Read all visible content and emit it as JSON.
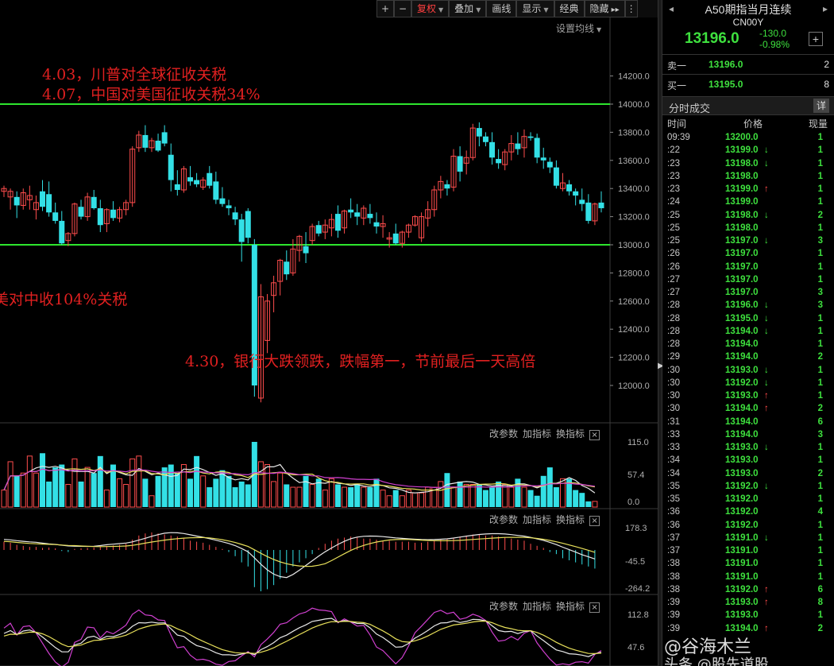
{
  "toolbar": {
    "buttons": [
      "+",
      "−",
      "复权",
      "叠加",
      "画线",
      "显示",
      "经典",
      "隐藏"
    ],
    "fuquan": "复权",
    "diejia": "叠加",
    "huaxian": "画线",
    "xianshi": "显示",
    "jingdian": "经典",
    "yincang": "隐藏",
    "more": "▸▸",
    "scroll": "⋮"
  },
  "setting_label": "设置均线",
  "annotations": {
    "a1": "4.03，川普对全球征收关税",
    "a2": "4.07，中国对美国征收关税34%",
    "a3": "美对中收104%关税",
    "a4": "4.30，银行大跌领跌，跌幅第一，节前最后一天高倍"
  },
  "price_axis": [
    "14200.0",
    "14000.0",
    "13800.0",
    "13600.0",
    "13400.0",
    "13200.0",
    "13000.0",
    "12800.0",
    "12600.0",
    "12400.0",
    "12200.0",
    "12000.0"
  ],
  "hlines": [
    14000,
    13000
  ],
  "panels": {
    "vol": {
      "ctrl": [
        "改参数",
        "加指标",
        "换指标"
      ],
      "axis": [
        "115.0",
        "57.4",
        "0.0"
      ]
    },
    "macd": {
      "ctrl": [
        "改参数",
        "加指标",
        "换指标"
      ],
      "axis": [
        "178.3",
        "-45.5",
        "-264.2"
      ]
    },
    "kdj": {
      "ctrl": [
        "改参数",
        "加指标",
        "换指标"
      ],
      "axis": [
        "112.8",
        "47.6"
      ]
    }
  },
  "colors": {
    "up": "#ff4d4d",
    "down": "#33e0e6",
    "line_green": "#2ee62e",
    "annot_red": "#e02020",
    "ma_white": "#e8e8e8",
    "ma_yellow": "#e8e05a",
    "ma_magenta": "#d040d0"
  },
  "chart_data": {
    "type": "candlestick",
    "y_range": [
      11900,
      14300
    ],
    "candles": [
      [
        13380,
        13420,
        13340,
        13400
      ],
      [
        13340,
        13400,
        13250,
        13380
      ],
      [
        13340,
        13380,
        13190,
        13280
      ],
      [
        13280,
        13400,
        13250,
        13370
      ],
      [
        13320,
        13420,
        13250,
        13350
      ],
      [
        13250,
        13350,
        13180,
        13300
      ],
      [
        13380,
        13460,
        13240,
        13270
      ],
      [
        13360,
        13450,
        13200,
        13230
      ],
      [
        13230,
        13300,
        13150,
        13170
      ],
      [
        13170,
        13240,
        13000,
        13010
      ],
      [
        13030,
        13090,
        12990,
        13080
      ],
      [
        13080,
        13300,
        13060,
        13290
      ],
      [
        13270,
        13320,
        13180,
        13200
      ],
      [
        13200,
        13370,
        13170,
        13340
      ],
      [
        13340,
        13390,
        13250,
        13260
      ],
      [
        13260,
        13320,
        13090,
        13140
      ],
      [
        13150,
        13260,
        13090,
        13250
      ],
      [
        13250,
        13310,
        13170,
        13190
      ],
      [
        13190,
        13270,
        13160,
        13250
      ],
      [
        13250,
        13320,
        13210,
        13300
      ],
      [
        13300,
        13700,
        13270,
        13680
      ],
      [
        13690,
        13810,
        13660,
        13780
      ],
      [
        13780,
        13850,
        13660,
        13690
      ],
      [
        13690,
        13760,
        13660,
        13740
      ],
      [
        13740,
        13790,
        13660,
        13670
      ],
      [
        13800,
        13850,
        13700,
        13720
      ],
      [
        13640,
        13720,
        13380,
        13460
      ],
      [
        13430,
        13530,
        13350,
        13390
      ],
      [
        13390,
        13560,
        13370,
        13540
      ],
      [
        13480,
        13560,
        13420,
        13450
      ],
      [
        13460,
        13510,
        13410,
        13430
      ],
      [
        13410,
        13480,
        13390,
        13460
      ],
      [
        13510,
        13560,
        13400,
        13420
      ],
      [
        13450,
        13520,
        13290,
        13320
      ],
      [
        13330,
        13410,
        13270,
        13290
      ],
      [
        13280,
        13320,
        13210,
        13260
      ],
      [
        13230,
        13270,
        13140,
        13180
      ],
      [
        13180,
        13220,
        12880,
        13020
      ],
      [
        13240,
        13260,
        13010,
        13050
      ],
      [
        13000,
        13040,
        11920,
        12000
      ],
      [
        11910,
        12720,
        11880,
        12630
      ],
      [
        12320,
        12650,
        12230,
        12600
      ],
      [
        12640,
        12780,
        12520,
        12730
      ],
      [
        12740,
        12900,
        12640,
        12890
      ],
      [
        12880,
        12960,
        12750,
        12790
      ],
      [
        12800,
        13040,
        12780,
        12970
      ],
      [
        12960,
        13070,
        12880,
        13060
      ],
      [
        12990,
        13090,
        12870,
        12940
      ],
      [
        13030,
        13150,
        13000,
        13130
      ],
      [
        13140,
        13170,
        13060,
        13080
      ],
      [
        13090,
        13180,
        13040,
        13140
      ],
      [
        13120,
        13220,
        13060,
        13180
      ],
      [
        13220,
        13280,
        13050,
        13100
      ],
      [
        13120,
        13250,
        13080,
        13240
      ],
      [
        13250,
        13330,
        13190,
        13230
      ],
      [
        13230,
        13290,
        13140,
        13200
      ],
      [
        13190,
        13280,
        13140,
        13260
      ],
      [
        13220,
        13290,
        13150,
        13190
      ],
      [
        13160,
        13230,
        13080,
        13130
      ],
      [
        13130,
        13210,
        13050,
        13150
      ],
      [
        13040,
        13090,
        12980,
        13050
      ],
      [
        13080,
        13150,
        13000,
        13010
      ],
      [
        13010,
        13100,
        12980,
        13090
      ],
      [
        13090,
        13150,
        13050,
        13140
      ],
      [
        13140,
        13210,
        13130,
        13200
      ],
      [
        13050,
        13230,
        13020,
        13200
      ],
      [
        13190,
        13310,
        13130,
        13250
      ],
      [
        13250,
        13420,
        13200,
        13390
      ],
      [
        13390,
        13490,
        13330,
        13450
      ],
      [
        13430,
        13460,
        13350,
        13400
      ],
      [
        13410,
        13680,
        13380,
        13630
      ],
      [
        13630,
        13700,
        13450,
        13520
      ],
      [
        13580,
        13670,
        13500,
        13620
      ],
      [
        13620,
        13860,
        13600,
        13830
      ],
      [
        13830,
        13870,
        13700,
        13770
      ],
      [
        13770,
        13800,
        13700,
        13730
      ],
      [
        13730,
        13800,
        13570,
        13620
      ],
      [
        13610,
        13680,
        13540,
        13580
      ],
      [
        13570,
        13680,
        13530,
        13660
      ],
      [
        13660,
        13780,
        13600,
        13720
      ],
      [
        13720,
        13800,
        13640,
        13680
      ],
      [
        13690,
        13820,
        13620,
        13770
      ],
      [
        13770,
        13800,
        13740,
        13760
      ],
      [
        13760,
        13790,
        13580,
        13620
      ],
      [
        13620,
        13690,
        13540,
        13600
      ],
      [
        13590,
        13620,
        13510,
        13550
      ],
      [
        13550,
        13600,
        13400,
        13420
      ],
      [
        13400,
        13510,
        13380,
        13440
      ],
      [
        13430,
        13460,
        13350,
        13380
      ],
      [
        13380,
        13400,
        13280,
        13350
      ],
      [
        13320,
        13400,
        13240,
        13290
      ],
      [
        13300,
        13360,
        13150,
        13170
      ],
      [
        13170,
        13300,
        13140,
        13290
      ],
      [
        13300,
        13380,
        13230,
        13260
      ]
    ],
    "volume": [
      30,
      80,
      55,
      60,
      90,
      60,
      95,
      45,
      70,
      75,
      40,
      85,
      45,
      70,
      60,
      90,
      30,
      75,
      50,
      40,
      85,
      90,
      50,
      20,
      55,
      70,
      75,
      60,
      75,
      50,
      90,
      55,
      35,
      50,
      65,
      55,
      35,
      45,
      40,
      115,
      80,
      75,
      45,
      60,
      40,
      35,
      35,
      55,
      40,
      50,
      30,
      50,
      40,
      35,
      35,
      40,
      35,
      35,
      50,
      30,
      20,
      30,
      20,
      30,
      25,
      25,
      35,
      35,
      45,
      60,
      35,
      45,
      40,
      40,
      40,
      30,
      35,
      45,
      40,
      35,
      50,
      35,
      30,
      20,
      55,
      70,
      35,
      50,
      50,
      30,
      25,
      10,
      10
    ],
    "macd_hist": [
      40,
      35,
      25,
      20,
      15,
      15,
      10,
      12,
      8,
      -5,
      -10,
      5,
      8,
      10,
      12,
      15,
      20,
      22,
      25,
      30,
      50,
      70,
      80,
      85,
      80,
      75,
      70,
      65,
      55,
      45,
      40,
      35,
      25,
      15,
      5,
      -10,
      -30,
      -60,
      -80,
      -180,
      -200,
      -190,
      -170,
      -140,
      -110,
      -80,
      -60,
      -40,
      -20,
      10,
      30,
      45,
      55,
      60,
      65,
      60,
      55,
      55,
      50,
      45,
      45,
      40,
      40,
      40,
      35,
      35,
      40,
      45,
      50,
      55,
      60,
      65,
      70,
      75,
      75,
      70,
      70,
      65,
      60,
      55,
      50,
      45,
      30,
      20,
      10,
      -10,
      -20,
      -40,
      -50,
      -60,
      -70,
      -80,
      -90
    ]
  },
  "right_panel": {
    "title": "A50期指当月连续",
    "code": "CN00Y",
    "nav_prev": "◂",
    "nav_next": "▸",
    "price": "13196.0",
    "change": "-130.0",
    "change_pct": "-0.98%",
    "plus": "+",
    "sell_label": "卖一",
    "sell_price": "13196.0",
    "sell_vol": "2",
    "buy_label": "买一",
    "buy_price": "13195.0",
    "buy_vol": "8",
    "ticks_title": "分时成交",
    "detail_btn": "详",
    "col_time": "时间",
    "col_price": "价格",
    "col_vol": "现量",
    "ticks": [
      {
        "t": "09:39",
        "p": "13200.0",
        "a": "",
        "v": "1"
      },
      {
        "t": ":22",
        "p": "13199.0",
        "a": "dn",
        "v": "1"
      },
      {
        "t": ":23",
        "p": "13198.0",
        "a": "dn",
        "v": "1"
      },
      {
        "t": ":23",
        "p": "13198.0",
        "a": "",
        "v": "1"
      },
      {
        "t": ":23",
        "p": "13199.0",
        "a": "up",
        "v": "1"
      },
      {
        "t": ":24",
        "p": "13199.0",
        "a": "",
        "v": "1"
      },
      {
        "t": ":25",
        "p": "13198.0",
        "a": "dn",
        "v": "2"
      },
      {
        "t": ":25",
        "p": "13198.0",
        "a": "",
        "v": "1"
      },
      {
        "t": ":25",
        "p": "13197.0",
        "a": "dn",
        "v": "3"
      },
      {
        "t": ":26",
        "p": "13197.0",
        "a": "",
        "v": "1"
      },
      {
        "t": ":26",
        "p": "13197.0",
        "a": "",
        "v": "1"
      },
      {
        "t": ":27",
        "p": "13197.0",
        "a": "",
        "v": "1"
      },
      {
        "t": ":27",
        "p": "13197.0",
        "a": "",
        "v": "3"
      },
      {
        "t": ":28",
        "p": "13196.0",
        "a": "dn",
        "v": "3"
      },
      {
        "t": ":28",
        "p": "13195.0",
        "a": "dn",
        "v": "1"
      },
      {
        "t": ":28",
        "p": "13194.0",
        "a": "dn",
        "v": "1"
      },
      {
        "t": ":28",
        "p": "13194.0",
        "a": "",
        "v": "1"
      },
      {
        "t": ":29",
        "p": "13194.0",
        "a": "",
        "v": "2"
      },
      {
        "t": ":30",
        "p": "13193.0",
        "a": "dn",
        "v": "1"
      },
      {
        "t": ":30",
        "p": "13192.0",
        "a": "dn",
        "v": "1"
      },
      {
        "t": ":30",
        "p": "13193.0",
        "a": "up",
        "v": "1"
      },
      {
        "t": ":30",
        "p": "13194.0",
        "a": "up",
        "v": "2"
      },
      {
        "t": ":31",
        "p": "13194.0",
        "a": "",
        "v": "6"
      },
      {
        "t": ":33",
        "p": "13194.0",
        "a": "",
        "v": "3"
      },
      {
        "t": ":33",
        "p": "13193.0",
        "a": "dn",
        "v": "1"
      },
      {
        "t": ":34",
        "p": "13193.0",
        "a": "",
        "v": "1"
      },
      {
        "t": ":34",
        "p": "13193.0",
        "a": "",
        "v": "2"
      },
      {
        "t": ":35",
        "p": "13192.0",
        "a": "dn",
        "v": "1"
      },
      {
        "t": ":35",
        "p": "13192.0",
        "a": "",
        "v": "1"
      },
      {
        "t": ":36",
        "p": "13192.0",
        "a": "",
        "v": "4"
      },
      {
        "t": ":36",
        "p": "13192.0",
        "a": "",
        "v": "1"
      },
      {
        "t": ":37",
        "p": "13191.0",
        "a": "dn",
        "v": "1"
      },
      {
        "t": ":37",
        "p": "13191.0",
        "a": "",
        "v": "1"
      },
      {
        "t": ":38",
        "p": "13191.0",
        "a": "",
        "v": "1"
      },
      {
        "t": ":38",
        "p": "13191.0",
        "a": "",
        "v": "1"
      },
      {
        "t": ":38",
        "p": "13192.0",
        "a": "up",
        "v": "6"
      },
      {
        "t": ":39",
        "p": "13193.0",
        "a": "up",
        "v": "8"
      },
      {
        "t": ":39",
        "p": "13193.0",
        "a": "",
        "v": "1"
      },
      {
        "t": ":39",
        "p": "13194.0",
        "a": "up",
        "v": "2"
      }
    ]
  },
  "watermark": "@谷海木兰",
  "watermark2": "头条 @股先道股"
}
